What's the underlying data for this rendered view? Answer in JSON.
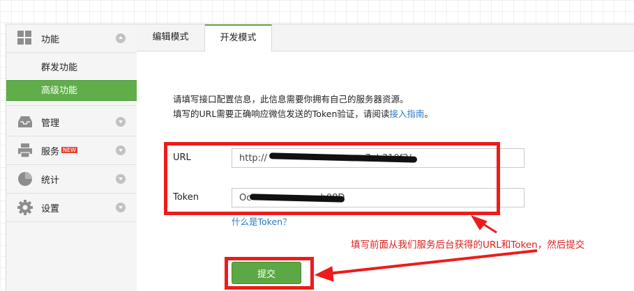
{
  "sidebar": {
    "sections": [
      {
        "label": "功能",
        "icon": "grid-icon",
        "expanded": true
      },
      {
        "label": "管理",
        "icon": "inbox-icon",
        "expanded": false
      },
      {
        "label": "服务",
        "icon": "printer-icon",
        "expanded": false,
        "badge": "NEW"
      },
      {
        "label": "统计",
        "icon": "pie-chart-icon",
        "expanded": false
      },
      {
        "label": "设置",
        "icon": "gear-icon",
        "expanded": false
      }
    ],
    "sub_items": [
      {
        "label": "群发功能",
        "active": false
      },
      {
        "label": "高级功能",
        "active": true
      }
    ]
  },
  "tabs": [
    {
      "label": "编辑模式",
      "active": false
    },
    {
      "label": "开发模式",
      "active": true
    }
  ],
  "description": {
    "line1": "请填写接口配置信息，此信息需要你拥有自己的服务器资源。",
    "line2_prefix": "填写的URL需要正确响应微信发送的Token验证，请阅读",
    "line2_link": "接入指南",
    "line2_suffix": "。"
  },
  "form": {
    "url_label": "URL",
    "url_value": "http://                                  7eb310f2/",
    "token_label": "Token",
    "token_value": "Oc                        b08D",
    "help_link": "什么是Token？",
    "submit_label": "提交"
  },
  "annotation": {
    "text": "填写前面从我们服务后台获得的URL和Token，然后提交"
  },
  "colors": {
    "accent_green": "#5fae4a",
    "annotation_red": "#ee1b1b",
    "link_blue": "#2a78c5"
  }
}
